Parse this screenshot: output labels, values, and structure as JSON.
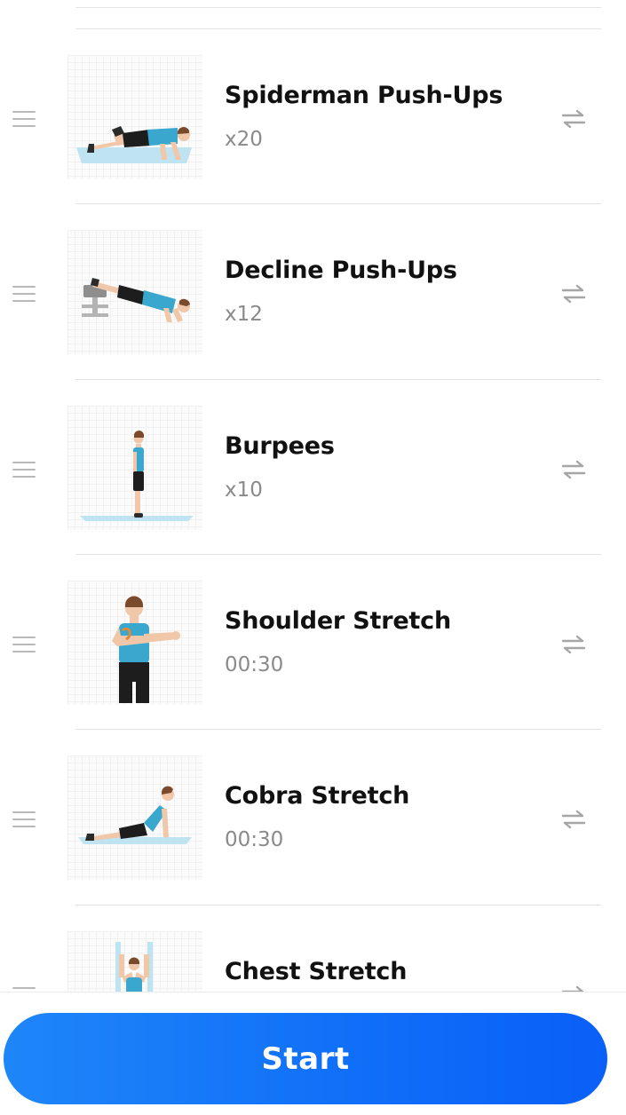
{
  "exercises": [
    {
      "name": "Spiderman Push-Ups",
      "amount": "x20",
      "illustration": "spiderman-pushup-illustration"
    },
    {
      "name": "Decline Push-Ups",
      "amount": "x12",
      "illustration": "decline-pushup-illustration"
    },
    {
      "name": "Burpees",
      "amount": "x10",
      "illustration": "burpees-illustration"
    },
    {
      "name": "Shoulder Stretch",
      "amount": "00:30",
      "illustration": "shoulder-stretch-illustration"
    },
    {
      "name": "Cobra Stretch",
      "amount": "00:30",
      "illustration": "cobra-stretch-illustration"
    },
    {
      "name": "Chest Stretch",
      "amount": "",
      "illustration": "chest-stretch-illustration"
    }
  ],
  "icons": {
    "drag": "drag-handle-icon",
    "swap": "swap-icon"
  },
  "start_button": {
    "label": "Start"
  },
  "colors": {
    "accent_start": "#1f86f9",
    "accent_end": "#0a5ff7",
    "shirt": "#3aa7cf",
    "mat": "#bfe3f1",
    "skin": "#f0c7a8",
    "hair": "#7a4a2a",
    "shorts": "#1d1d1d",
    "muted_text": "#8a8a8a",
    "icon_gray": "#a6a6a6"
  }
}
